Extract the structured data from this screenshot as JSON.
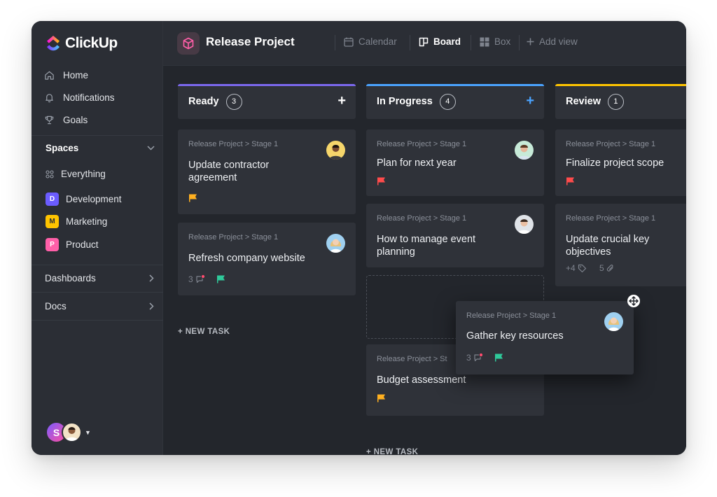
{
  "app": {
    "name": "ClickUp"
  },
  "sidebar": {
    "nav": [
      {
        "label": "Home",
        "icon": "home-icon"
      },
      {
        "label": "Notifications",
        "icon": "bell-icon"
      },
      {
        "label": "Goals",
        "icon": "trophy-icon"
      }
    ],
    "spaces_label": "Spaces",
    "everything_label": "Everything",
    "spaces": [
      {
        "letter": "D",
        "label": "Development",
        "color": "#6b5cff"
      },
      {
        "letter": "M",
        "label": "Marketing",
        "color": "#ffc400"
      },
      {
        "letter": "P",
        "label": "Product",
        "color": "#ff5fa8"
      }
    ],
    "dashboards_label": "Dashboards",
    "docs_label": "Docs",
    "user_initial": "S"
  },
  "topbar": {
    "project_title": "Release Project",
    "views": [
      {
        "label": "Calendar",
        "icon": "calendar-icon"
      },
      {
        "label": "Board",
        "icon": "board-icon"
      },
      {
        "label": "Box",
        "icon": "box-icon"
      },
      {
        "label": "Add view",
        "icon": "plus-icon"
      }
    ],
    "active_view": "Board"
  },
  "board": {
    "columns": [
      {
        "title": "Ready",
        "count": "3",
        "color": "#7b68ee",
        "plus_color": "#ffffff"
      },
      {
        "title": "In Progress",
        "count": "4",
        "color": "#4aa3ff",
        "plus_color": "#4aa3ff"
      },
      {
        "title": "Review",
        "count": "1",
        "color": "#ffc400"
      }
    ],
    "cards": {
      "ready": [
        {
          "crumb": "Release Project > Stage 1",
          "title": "Update contractor agreement",
          "flag": "#ffb020"
        },
        {
          "crumb": "Release Project > Stage 1",
          "title": "Refresh company website",
          "comments": "3",
          "flag": "#2fc99a"
        }
      ],
      "progress": [
        {
          "crumb": "Release Project > Stage 1",
          "title": "Plan for next year",
          "flag": "#ff4b4b"
        },
        {
          "crumb": "Release Project > Stage 1",
          "title": "How to manage event planning"
        },
        {
          "crumb": "Release Project > St",
          "title": "Budget assessment",
          "flag": "#ffb020"
        }
      ],
      "review": [
        {
          "crumb": "Release Project > Stage 1",
          "title": "Finalize project scope",
          "flag": "#ff4b4b"
        },
        {
          "crumb": "Release Project > Stage 1",
          "title": "Update crucial key objectives",
          "tags": "+4",
          "attachments": "5"
        }
      ]
    },
    "dragging": {
      "crumb": "Release Project > Stage 1",
      "title": "Gather key resources",
      "comments": "3",
      "flag": "#2fc99a"
    },
    "new_task_label": "+ NEW TASK"
  }
}
